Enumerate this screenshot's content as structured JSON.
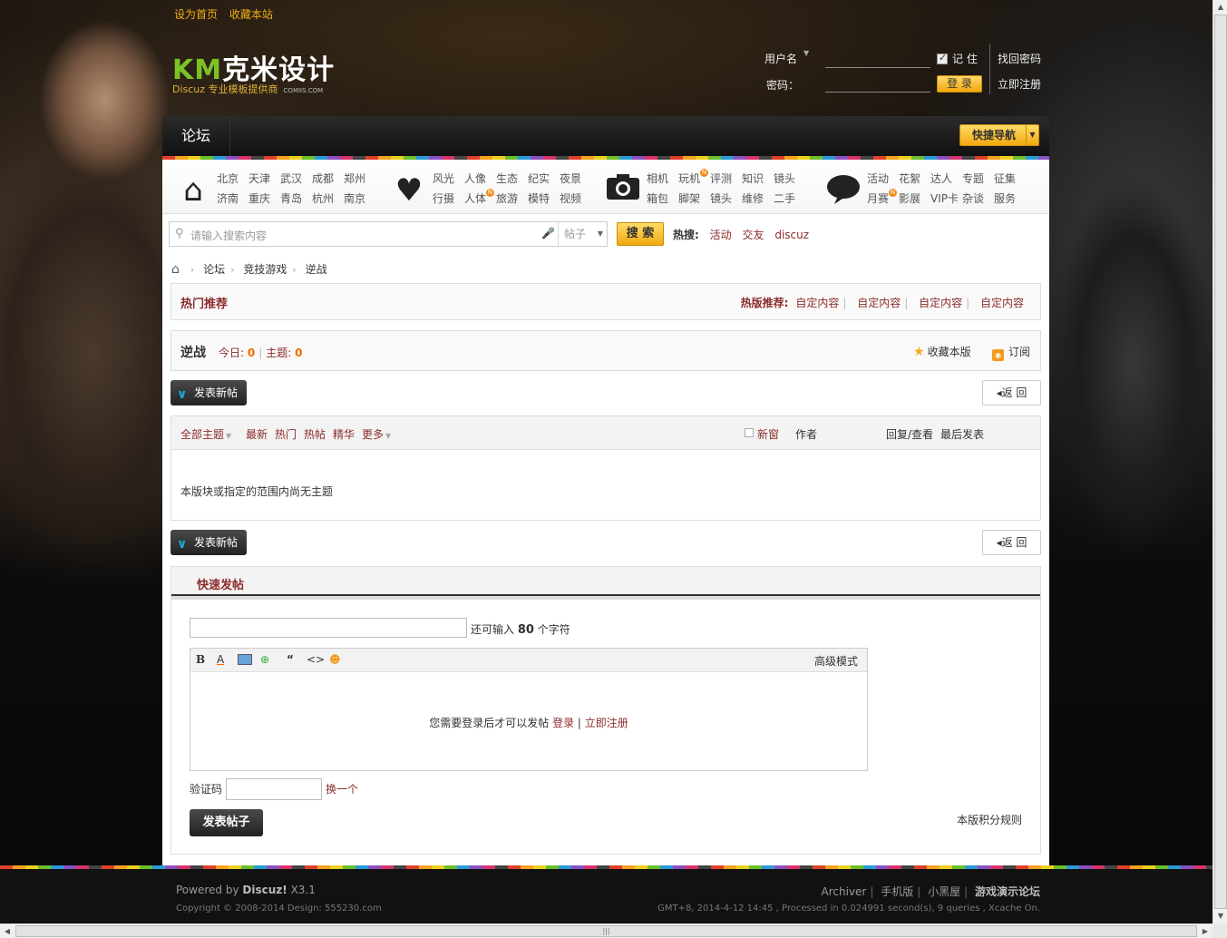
{
  "top_links": [
    "设为首页",
    "收藏本站"
  ],
  "logo": {
    "brand": "克米设计",
    "sub": "Discuz 专业模板提供商",
    "domain": "COMIIS.COM"
  },
  "login": {
    "username_label": "用户名",
    "password_label": "密码：",
    "remember": "记 住",
    "login_btn": "登 录",
    "forgot": "找回密码",
    "register": "立即注册"
  },
  "nav": {
    "forum": "论坛",
    "quick_nav": "快捷导航"
  },
  "categories": [
    {
      "icon": "home-icon",
      "links": [
        "北京",
        "天津",
        "武汉",
        "成都",
        "郑州",
        "济南",
        "重庆",
        "青岛",
        "杭州",
        "南京"
      ]
    },
    {
      "icon": "heart-icon",
      "links": [
        "风光",
        "人像",
        "生态",
        "纪实",
        "夜景",
        "行摄",
        "人体",
        "旅游",
        "模特",
        "视频"
      ]
    },
    {
      "icon": "camera-icon",
      "links": [
        "相机",
        "玩机",
        "评测",
        "知识",
        "镜头",
        "箱包",
        "脚架",
        "镜头",
        "维修",
        "二手"
      ]
    },
    {
      "icon": "speech-bubble-icon",
      "links": [
        "活动",
        "花絮",
        "达人",
        "专题",
        "征集",
        "月赛",
        "影展",
        "VIP卡",
        "杂谈",
        "服务"
      ]
    }
  ],
  "search": {
    "placeholder": "请输入搜索内容",
    "type": "帖子",
    "button": "搜 索",
    "hot_label": "热搜:",
    "hot": [
      "活动",
      "交友",
      "discuz"
    ]
  },
  "breadcrumb": [
    "论坛",
    "竞技游戏",
    "逆战"
  ],
  "hot_rec": {
    "title": "热门推荐",
    "label": "热版推荐:",
    "items": [
      "自定内容",
      "自定内容",
      "自定内容",
      "自定内容"
    ]
  },
  "forum": {
    "name": "逆战",
    "today_label": "今日:",
    "today": "0",
    "topics_label": "主题:",
    "topics": "0",
    "fav": "收藏本版",
    "subscribe": "订阅"
  },
  "actions": {
    "new_post": "发表新帖",
    "back": "返 回"
  },
  "thread_list": {
    "filters": [
      "全部主题",
      "最新",
      "热门",
      "热帖",
      "精华",
      "更多"
    ],
    "new_window": "新窗",
    "author": "作者",
    "reply_view": "回复/查看",
    "last_post": "最后发表",
    "empty": "本版块或指定的范围内尚无主题"
  },
  "quick_post": {
    "title": "快速发帖",
    "remain_pre": "还可输入",
    "remain_num": "80",
    "remain_post": "个字符",
    "advanced": "高级模式",
    "need_login": "您需要登录后才可以发帖",
    "login": "登录",
    "register": "立即注册",
    "captcha": "验证码",
    "change": "换一个",
    "submit": "发表帖子",
    "rules": "本版积分规则"
  },
  "footer": {
    "powered": "Powered by",
    "discuz": "Discuz!",
    "version": "X3.1",
    "copyright": "Copyright © 2008-2014 Design: 555230.com",
    "links": [
      "Archiver",
      "手机版",
      "小黑屋"
    ],
    "site": "游戏演示论坛",
    "info": "GMT+8, 2014-4-12 14:45 , Processed in 0.024991 second(s), 9 queries , Xcache On."
  }
}
